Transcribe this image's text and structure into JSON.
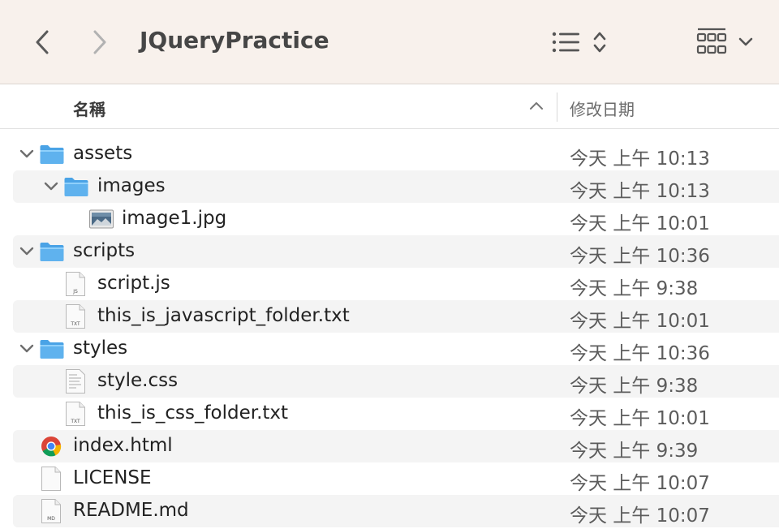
{
  "window": {
    "title": "JQueryPractice"
  },
  "columns": {
    "name": "名稱",
    "date_modified": "修改日期"
  },
  "rows": [
    {
      "name": "assets",
      "date": "今天 上午 10:13",
      "type": "folder",
      "depth": 0,
      "expanded": true
    },
    {
      "name": "images",
      "date": "今天 上午 10:13",
      "type": "folder",
      "depth": 1,
      "expanded": true
    },
    {
      "name": "image1.jpg",
      "date": "今天 上午 10:01",
      "type": "image",
      "depth": 2
    },
    {
      "name": "scripts",
      "date": "今天 上午 10:36",
      "type": "folder",
      "depth": 0,
      "expanded": true
    },
    {
      "name": "script.js",
      "date": "今天 上午 9:38",
      "type": "doc",
      "badge": "JS",
      "depth": 1
    },
    {
      "name": "this_is_javascript_folder.txt",
      "date": "今天 上午 10:01",
      "type": "doc",
      "badge": "TXT",
      "depth": 1
    },
    {
      "name": "styles",
      "date": "今天 上午 10:36",
      "type": "folder",
      "depth": 0,
      "expanded": true
    },
    {
      "name": "style.css",
      "date": "今天 上午 9:38",
      "type": "css",
      "depth": 1
    },
    {
      "name": "this_is_css_folder.txt",
      "date": "今天 上午 10:01",
      "type": "doc",
      "badge": "TXT",
      "depth": 1
    },
    {
      "name": "index.html",
      "date": "今天 上午 9:39",
      "type": "chrome",
      "depth": 0
    },
    {
      "name": "LICENSE",
      "date": "今天 上午 10:07",
      "type": "blank",
      "depth": 0
    },
    {
      "name": "README.md",
      "date": "今天 上午 10:07",
      "type": "doc",
      "badge": "MD",
      "depth": 0
    }
  ],
  "colors": {
    "toolbar_bg": "#f8f1ec",
    "folder_blue": "#5fb2ee",
    "row_alt": "#f4f4f4"
  },
  "icons": {
    "back": "chevron-left-icon",
    "forward": "chevron-right-icon",
    "list_view": "list-view-icon",
    "group": "grid-group-icon"
  }
}
